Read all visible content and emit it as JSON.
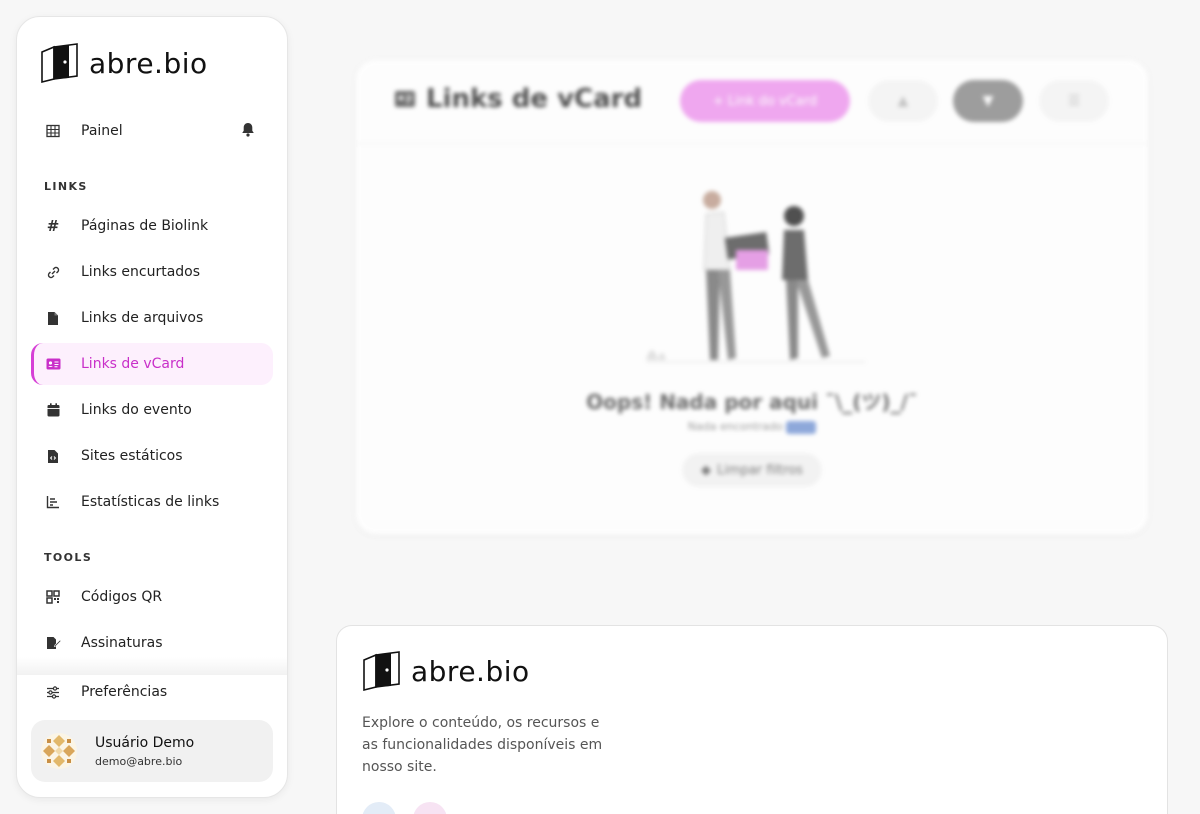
{
  "brand": {
    "name": "abre.bio"
  },
  "sidebar": {
    "dashboard": {
      "label": "Painel",
      "icon": "table-icon"
    },
    "sections": {
      "links": "LINKS",
      "tools": "TOOLS"
    },
    "links": [
      {
        "label": "Páginas de Biolink",
        "icon": "hash-icon"
      },
      {
        "label": "Links encurtados",
        "icon": "link-icon"
      },
      {
        "label": "Links de arquivos",
        "icon": "file-icon"
      },
      {
        "label": "Links de vCard",
        "icon": "id-card-icon",
        "active": true
      },
      {
        "label": "Links do evento",
        "icon": "calendar-icon"
      },
      {
        "label": "Sites estáticos",
        "icon": "file-code-icon"
      },
      {
        "label": "Estatísticas de links",
        "icon": "chart-icon"
      }
    ],
    "tools": [
      {
        "label": "Códigos QR",
        "icon": "qr-icon"
      },
      {
        "label": "Assinaturas",
        "icon": "signature-icon"
      }
    ],
    "preferences": {
      "label": "Preferências",
      "icon": "sliders-icon"
    },
    "user": {
      "name": "Usuário Demo",
      "email": "demo@abre.bio"
    }
  },
  "main": {
    "title": "Links de vCard",
    "create_label": "+ Link do vCard",
    "empty_title": "Oops! Nada por aqui ¯\\_(ツ)_/¯",
    "empty_sub": "Nada encontrado",
    "clear_label": "Limpar filtros"
  },
  "footer": {
    "description": "Explore o conteúdo, os recursos e as funcionalidades disponíveis em nosso site."
  },
  "colors": {
    "accent": "#d640d6",
    "accent_bg": "#fdf0fd"
  }
}
